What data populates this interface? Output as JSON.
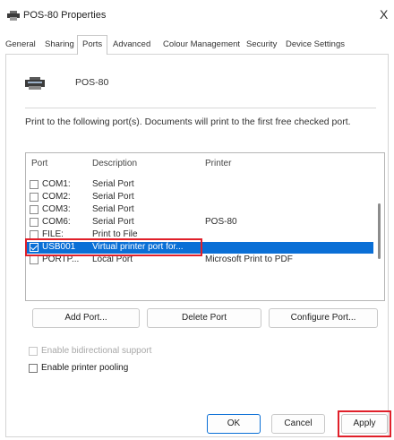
{
  "window": {
    "title": "POS-80 Properties",
    "close_glyph": "X"
  },
  "tabs": [
    {
      "label": "General"
    },
    {
      "label": "Sharing"
    },
    {
      "label": "Ports",
      "active": true
    },
    {
      "label": "Advanced"
    },
    {
      "label": "Colour Management"
    },
    {
      "label": "Security"
    },
    {
      "label": "Device Settings"
    }
  ],
  "printer": {
    "icon": "printer-icon",
    "name": "POS-80"
  },
  "instructions": "Print to the following port(s). Documents will print to the first free checked port.",
  "port_list": {
    "columns": [
      "Port",
      "Description",
      "Printer"
    ],
    "rows": [
      {
        "port": "COM1:",
        "description": "Serial Port",
        "printer": "",
        "checked": false,
        "selected": false
      },
      {
        "port": "COM2:",
        "description": "Serial Port",
        "printer": "",
        "checked": false,
        "selected": false
      },
      {
        "port": "COM3:",
        "description": "Serial Port",
        "printer": "",
        "checked": false,
        "selected": false
      },
      {
        "port": "COM6:",
        "description": "Serial Port",
        "printer": "POS-80",
        "checked": false,
        "selected": false
      },
      {
        "port": "FILE:",
        "description": "Print to File",
        "printer": "",
        "checked": false,
        "selected": false
      },
      {
        "port": "USB001",
        "description": "Virtual printer port for...",
        "printer": "",
        "checked": true,
        "selected": true
      },
      {
        "port": "PORTP...",
        "description": "Local Port",
        "printer": "Microsoft Print to PDF",
        "checked": false,
        "selected": false
      }
    ]
  },
  "port_buttons": {
    "add": "Add Port...",
    "delete": "Delete Port",
    "configure": "Configure Port..."
  },
  "options": {
    "bidirectional": {
      "label": "Enable bidirectional support",
      "checked": false,
      "disabled": true
    },
    "pooling": {
      "label": "Enable printer pooling",
      "checked": false,
      "disabled": false
    }
  },
  "footer": {
    "ok": "OK",
    "cancel": "Cancel",
    "apply": "Apply"
  },
  "colors": {
    "selection": "#0a6fd6",
    "highlight_box": "#e0202a"
  }
}
